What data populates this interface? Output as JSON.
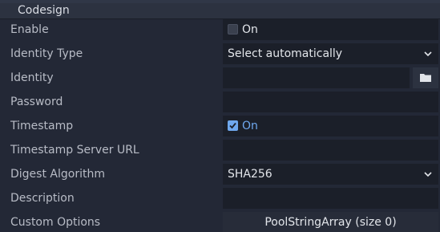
{
  "section": {
    "title": "Codesign"
  },
  "rows": [
    {
      "label": "Enable",
      "value": "On"
    },
    {
      "label": "Identity Type",
      "value": "Select automatically"
    },
    {
      "label": "Identity",
      "value": ""
    },
    {
      "label": "Password",
      "value": ""
    },
    {
      "label": "Timestamp",
      "value": "On"
    },
    {
      "label": "Timestamp Server URL",
      "value": ""
    },
    {
      "label": "Digest Algorithm",
      "value": "SHA256"
    },
    {
      "label": "Description",
      "value": ""
    },
    {
      "label": "Custom Options",
      "value": "PoolStringArray (size 0)"
    }
  ],
  "state": {
    "enable_checked": false,
    "timestamp_checked": true
  },
  "colors": {
    "accent": "#6fa8ee",
    "field_bg": "#1b1f29",
    "panel_bg": "#232836"
  },
  "icons": {
    "identity_browse": "folder-icon",
    "dropdown": "chevron-down-icon",
    "check": "checkmark-icon"
  }
}
